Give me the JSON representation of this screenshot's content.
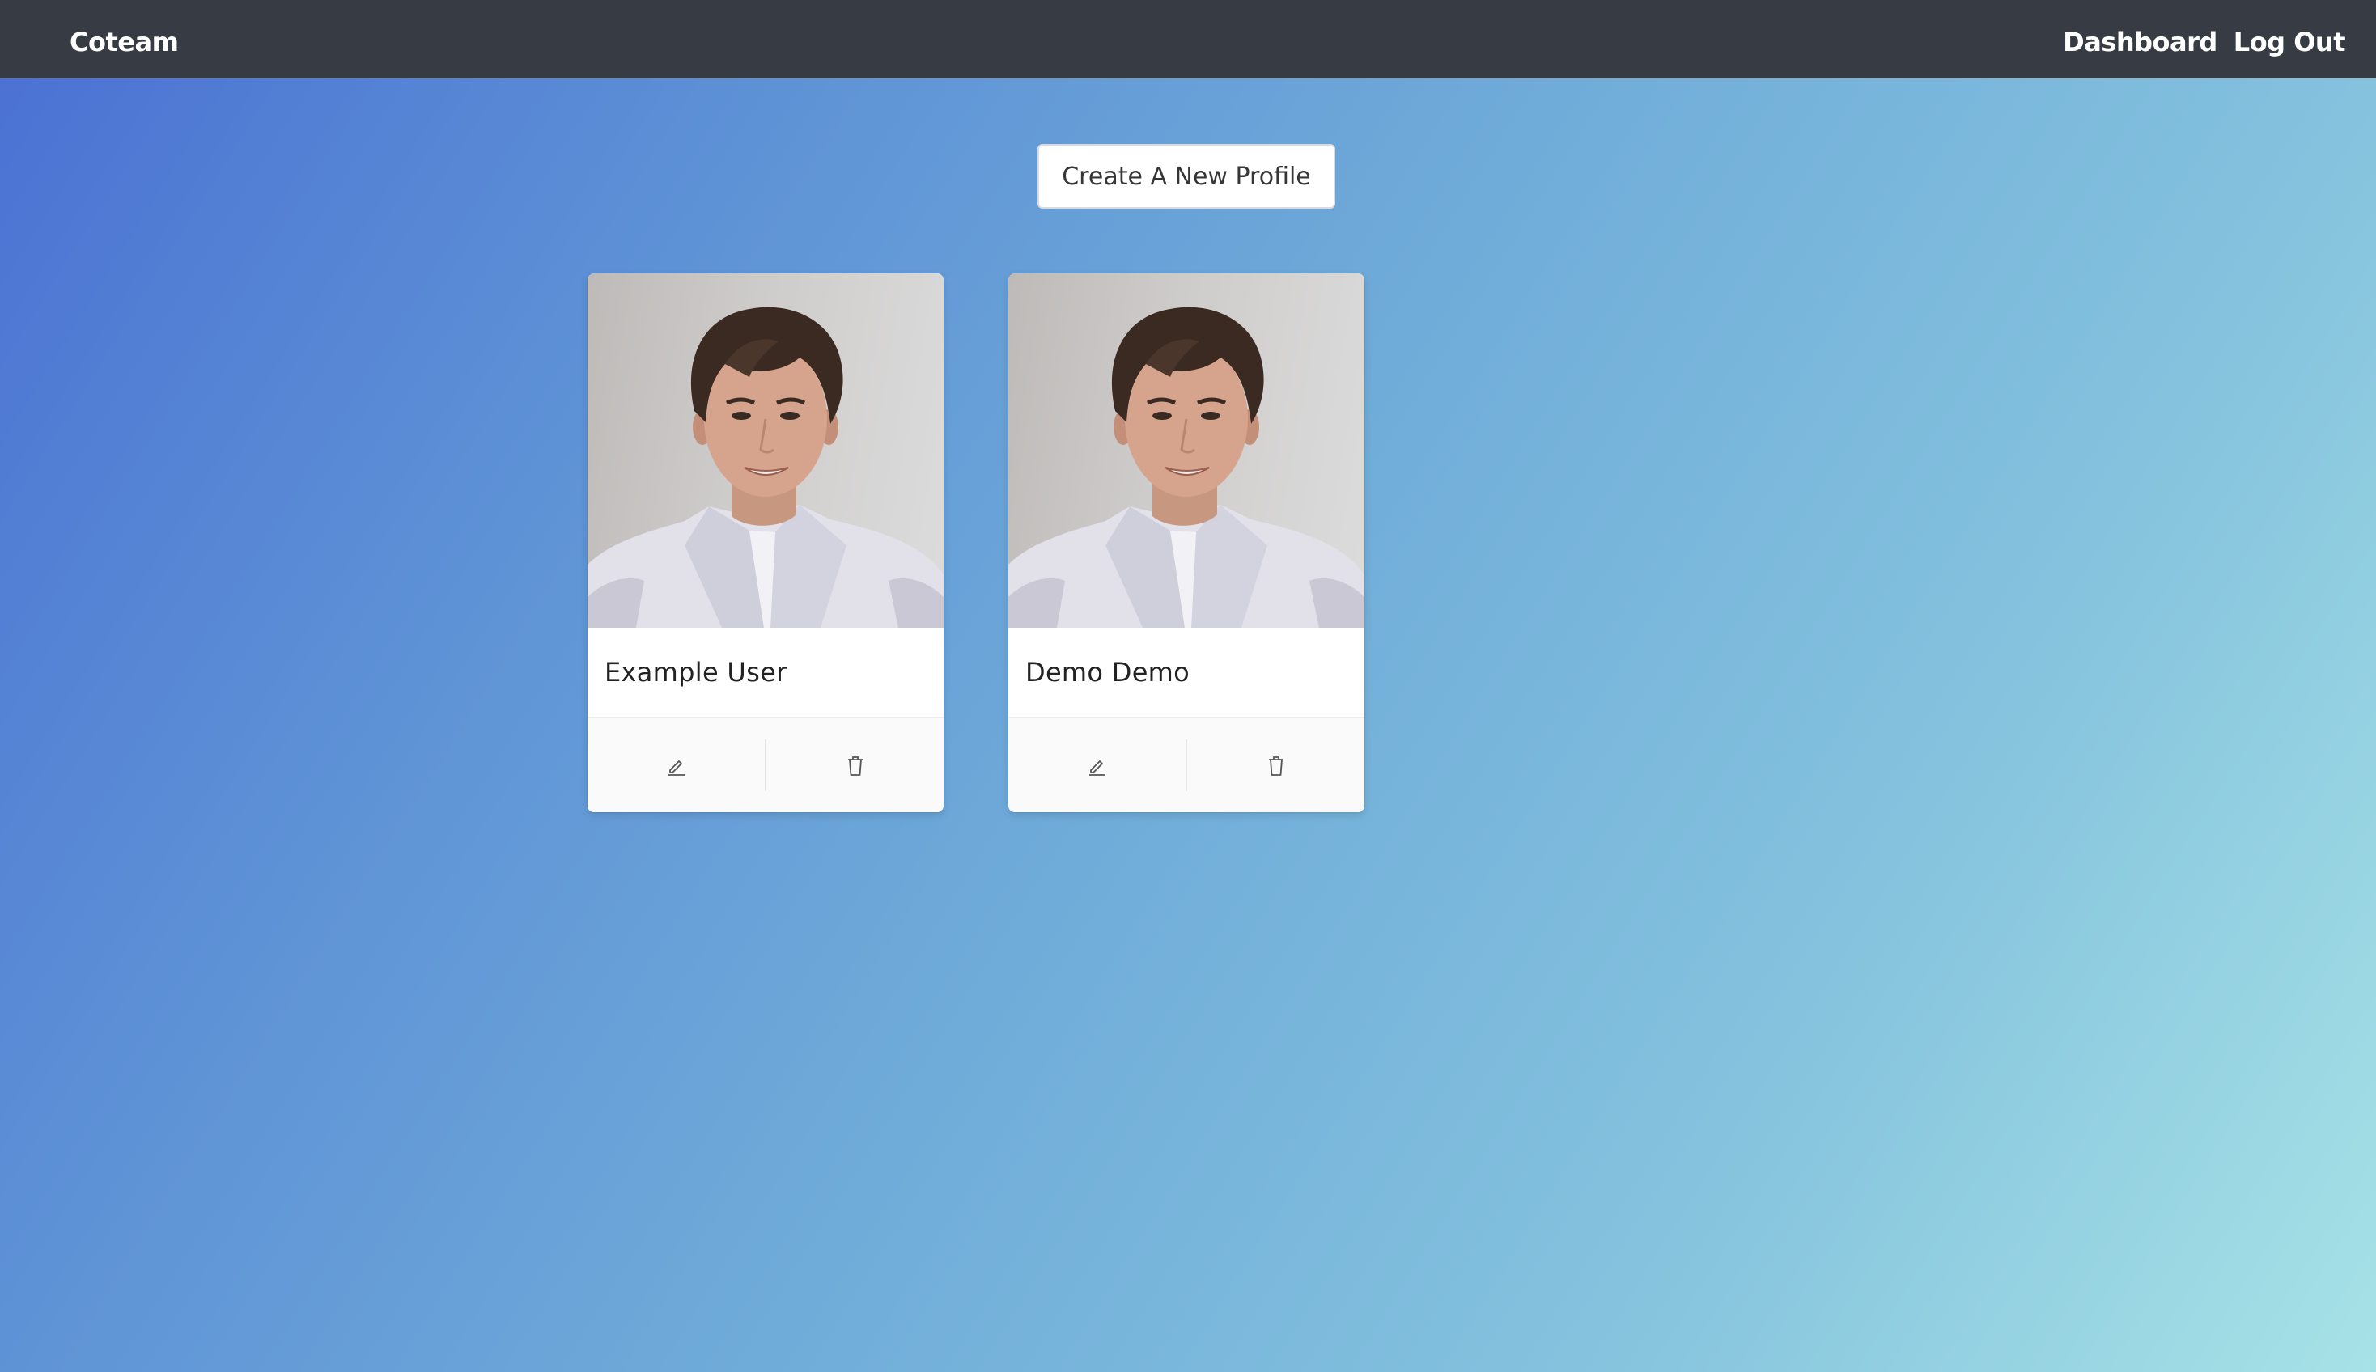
{
  "navbar": {
    "brand": "Coteam",
    "links": [
      "Dashboard",
      "Log Out"
    ]
  },
  "actions": {
    "create_label": "Create A New Profile"
  },
  "profiles": [
    {
      "name": "Example User",
      "edit_icon": "pencil-icon",
      "delete_icon": "trash-icon"
    },
    {
      "name": "Demo Demo",
      "edit_icon": "pencil-icon",
      "delete_icon": "trash-icon"
    }
  ],
  "colors": {
    "navbar_bg": "#363b44",
    "gradient_start": "#4a70d3",
    "gradient_end": "#a6e2e6",
    "card_bg": "#ffffff"
  }
}
